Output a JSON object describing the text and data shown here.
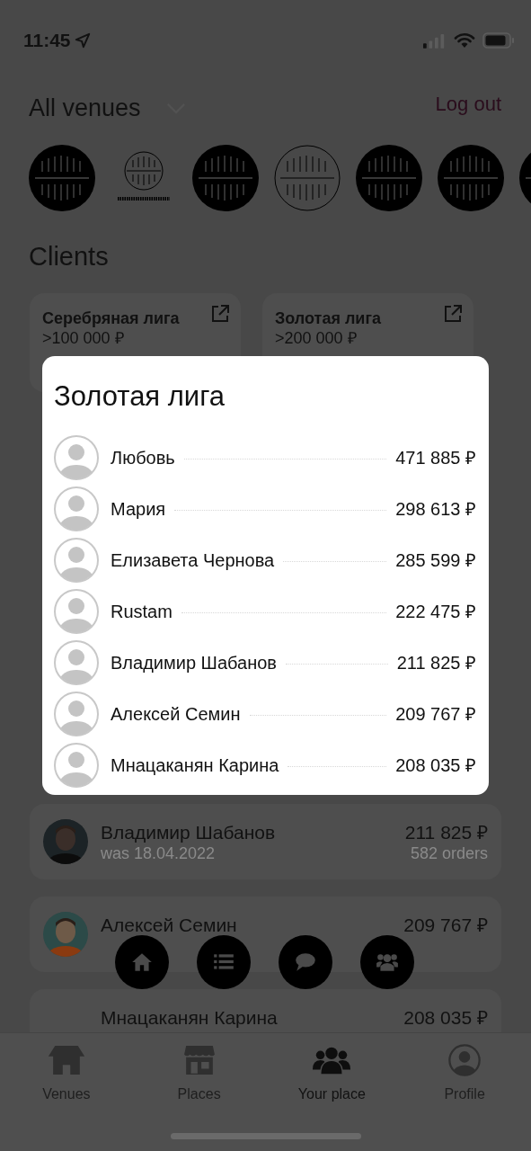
{
  "status_bar": {
    "time": "11:45"
  },
  "header": {
    "title": "All venues",
    "action": "Log out"
  },
  "venues": [
    {
      "kind": "filled"
    },
    {
      "kind": "badge"
    },
    {
      "kind": "filled"
    },
    {
      "kind": "outline"
    },
    {
      "kind": "filled"
    },
    {
      "kind": "filled"
    },
    {
      "kind": "filled"
    }
  ],
  "section_title": "Clients",
  "leagues": [
    {
      "name": "Серебряная лига",
      "threshold": ">100 000 ₽"
    },
    {
      "name": "Золотая лига",
      "threshold": ">200 000 ₽"
    }
  ],
  "clients": [
    {
      "name": "Владимир Шабанов",
      "last_visit": "was 18.04.2022",
      "total": "211 825 ₽",
      "orders": "582 orders"
    },
    {
      "name": "Алексей Семин",
      "total": "209 767 ₽"
    },
    {
      "name": "Мнацаканян Карина",
      "total": "208 035 ₽",
      "kind": "plain"
    }
  ],
  "fab_actions": [
    {
      "kind": "home"
    },
    {
      "kind": "list"
    },
    {
      "kind": "chat"
    },
    {
      "kind": "group"
    }
  ],
  "tabs": [
    {
      "label": "Venues",
      "kind": "house",
      "selected": false
    },
    {
      "label": "Places",
      "kind": "store",
      "selected": false
    },
    {
      "label": "Your place",
      "kind": "group",
      "selected": true
    },
    {
      "label": "Profile",
      "kind": "person",
      "selected": false
    }
  ],
  "modal": {
    "title": "Золотая лига",
    "rows": [
      {
        "name": "Любовь",
        "total": "471 885 ₽"
      },
      {
        "name": "Мария",
        "total": "298 613 ₽"
      },
      {
        "name": "Елизавета Чернова",
        "total": "285 599 ₽"
      },
      {
        "name": "Rustam",
        "total": "222 475 ₽"
      },
      {
        "name": "Владимир Шабанов",
        "total": "211 825 ₽"
      },
      {
        "name": "Алексей Семин",
        "total": "209 767 ₽"
      },
      {
        "name": "Мнацаканян Карина",
        "total": "208 035 ₽"
      }
    ]
  }
}
